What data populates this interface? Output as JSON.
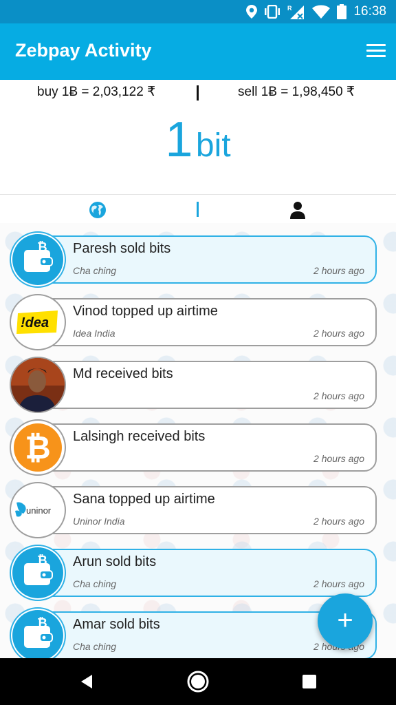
{
  "status_bar": {
    "time": "16:38",
    "icons": [
      "location-icon",
      "vibrate-icon",
      "signal-roaming-icon",
      "wifi-icon",
      "battery-icon"
    ]
  },
  "header": {
    "title": "Zebpay Activity",
    "menu_icon": "hamburger-menu-icon"
  },
  "rates": {
    "buy": "buy 1Ƀ = 2,03,122 ₹",
    "sell": "sell 1Ƀ = 1,98,450 ₹"
  },
  "amount": {
    "value": "1",
    "unit": "bit"
  },
  "tabs": [
    {
      "icon": "globe-icon"
    },
    {
      "icon": "user-icon"
    }
  ],
  "feed": [
    {
      "title": "Paresh sold bits",
      "sub": "Cha ching",
      "time": "2 hours ago",
      "avatar": "wallet-icon",
      "style": "blue"
    },
    {
      "title": "Vinod topped up airtime",
      "sub": "Idea India",
      "time": "2 hours ago",
      "avatar": "idea-logo",
      "logo_text": "!dea",
      "style": "grey"
    },
    {
      "title": "Md received bits",
      "sub": "",
      "time": "2 hours ago",
      "avatar": "user-photo",
      "style": "grey"
    },
    {
      "title": "Lalsingh received bits",
      "sub": "",
      "time": "2 hours ago",
      "avatar": "bitcoin-icon",
      "style": "grey"
    },
    {
      "title": "Sana topped up airtime",
      "sub": "Uninor India",
      "time": "2 hours ago",
      "avatar": "uninor-logo",
      "logo_text": "uninor",
      "style": "grey"
    },
    {
      "title": "Arun sold bits",
      "sub": "Cha ching",
      "time": "2 hours ago",
      "avatar": "wallet-icon",
      "style": "blue"
    },
    {
      "title": "Amar sold bits",
      "sub": "Cha ching",
      "time": "2 hours ago",
      "avatar": "wallet-icon",
      "style": "blue"
    }
  ],
  "fab": {
    "label": "+"
  },
  "colors": {
    "status_bar": "#0a8fc6",
    "app_bar": "#06ace3",
    "accent": "#1aa5dd",
    "bitcoin_orange": "#f7931a",
    "idea_yellow": "#ffe000"
  }
}
